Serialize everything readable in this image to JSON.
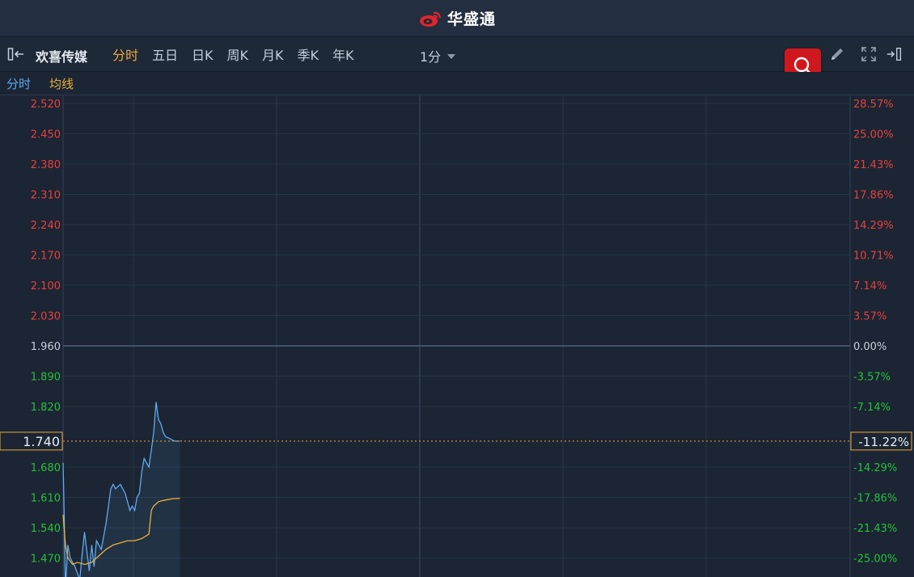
{
  "app": {
    "brand": "华盛通"
  },
  "toolbar": {
    "stock_name": "欢喜传媒",
    "tabs": [
      "分时",
      "五日",
      "日K",
      "周K",
      "月K",
      "季K",
      "年K"
    ],
    "active_tab": "分时",
    "interval": "1分"
  },
  "legend": {
    "price_label": "分时",
    "avg_label": "均线"
  },
  "colors": {
    "up": "#e8403c",
    "down": "#26c03a",
    "flat": "#c7d0dc",
    "price_line": "#5ea9ee",
    "avg_line": "#e9b13c",
    "accent": "#f2a73a",
    "search_bg": "#d0171e"
  },
  "chart_data": {
    "type": "line",
    "prev_close": 1.96,
    "ylim": [
      1.4,
      2.52
    ],
    "y_ticks_left": [
      "2.520",
      "2.450",
      "2.380",
      "2.310",
      "2.240",
      "2.170",
      "2.100",
      "2.030",
      "1.960",
      "1.890",
      "1.820",
      "1.680",
      "1.610",
      "1.540",
      "1.470"
    ],
    "y_ticks_right": [
      "28.57%",
      "25.00%",
      "21.43%",
      "17.86%",
      "14.29%",
      "10.71%",
      "7.14%",
      "3.57%",
      "0.00%",
      "-3.57%",
      "-7.14%",
      "-14.29%",
      "-17.86%",
      "-21.43%",
      "-25.00%"
    ],
    "crosshair": {
      "price": "1.740",
      "change": "-11.22%"
    },
    "x_range": [
      0,
      330
    ],
    "series": [
      {
        "key": "price",
        "x": [
          0,
          0.5,
          1,
          2,
          3,
          5,
          7,
          8,
          9,
          11,
          12,
          13,
          14,
          16,
          18,
          20,
          21,
          22,
          24,
          26,
          28,
          29,
          30,
          31,
          32,
          33,
          34,
          36,
          37,
          38,
          39,
          40,
          41,
          42,
          43,
          44,
          45,
          46,
          47,
          49
        ],
        "values": [
          1.69,
          1.56,
          1.4,
          1.5,
          1.47,
          1.45,
          1.42,
          1.48,
          1.53,
          1.44,
          1.5,
          1.45,
          1.51,
          1.49,
          1.55,
          1.63,
          1.64,
          1.63,
          1.64,
          1.62,
          1.58,
          1.59,
          1.58,
          1.61,
          1.62,
          1.67,
          1.7,
          1.68,
          1.72,
          1.76,
          1.83,
          1.79,
          1.78,
          1.76,
          1.75,
          1.748,
          1.745,
          1.742,
          1.74,
          1.74
        ]
      },
      {
        "key": "avg",
        "x": [
          0,
          1,
          2,
          4,
          6,
          9,
          12,
          14,
          16,
          18,
          21,
          24,
          27,
          30,
          33,
          36,
          37,
          38,
          39,
          40,
          42,
          44,
          46,
          49
        ],
        "values": [
          1.57,
          1.5,
          1.47,
          1.455,
          1.46,
          1.455,
          1.46,
          1.47,
          1.48,
          1.49,
          1.5,
          1.505,
          1.51,
          1.51,
          1.515,
          1.525,
          1.58,
          1.59,
          1.595,
          1.6,
          1.603,
          1.605,
          1.607,
          1.608
        ]
      }
    ]
  }
}
